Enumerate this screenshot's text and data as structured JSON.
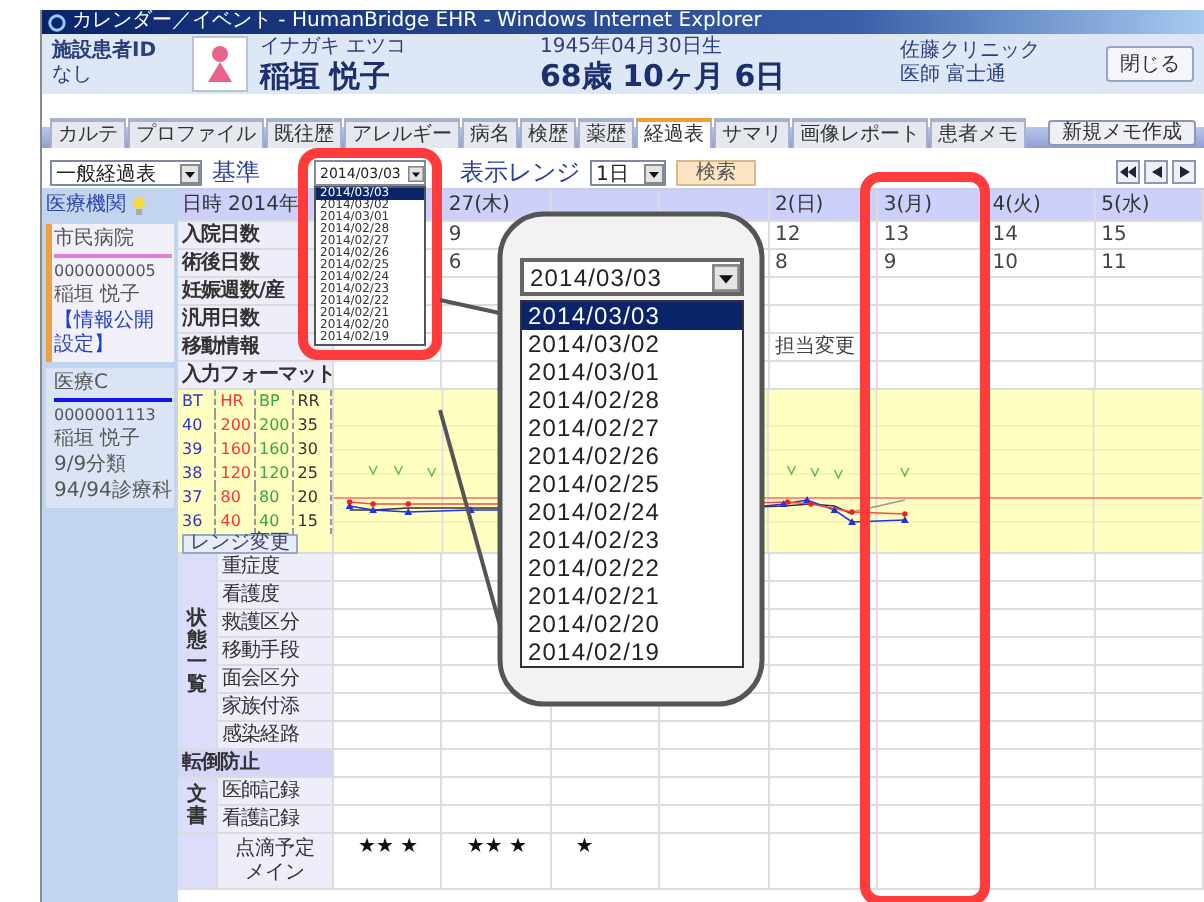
{
  "window": {
    "title": "カレンダー／イベント - HumanBridge EHR - Windows Internet Explorer"
  },
  "patient": {
    "id_label": "施設患者ID",
    "id_value": "なし",
    "kana": "イナガキ エツコ",
    "name": "稲垣 悦子",
    "birth": "1945年04月30日生",
    "age": "68歳 10ヶ月 6日",
    "clinic": "佐藤クリニック",
    "doctor": "医師 富士通",
    "close_button": "閉じる"
  },
  "tabs": [
    {
      "label": "カルテ",
      "selected": false
    },
    {
      "label": "プロファイル",
      "selected": false
    },
    {
      "label": "既往歴",
      "selected": false
    },
    {
      "label": "アレルギー",
      "selected": false
    },
    {
      "label": "病名",
      "selected": false
    },
    {
      "label": "検歴",
      "selected": false
    },
    {
      "label": "薬歴",
      "selected": false
    },
    {
      "label": "経過表",
      "selected": true
    },
    {
      "label": "サマリ",
      "selected": false
    },
    {
      "label": "画像レポート",
      "selected": false
    },
    {
      "label": "患者メモ",
      "selected": false
    }
  ],
  "new_memo_button": "新規メモ作成",
  "toolbar": {
    "table_select": "一般経過表",
    "base_date_label": "基準",
    "date_select": {
      "value": "2014/03/03",
      "expanded": true,
      "highlighted": true,
      "options": [
        {
          "label": "2014/03/03",
          "selected": true
        },
        {
          "label": "2014/03/02",
          "selected": false
        },
        {
          "label": "2014/03/01",
          "selected": false
        },
        {
          "label": "2014/02/28",
          "selected": false
        },
        {
          "label": "2014/02/27",
          "selected": false
        },
        {
          "label": "2014/02/26",
          "selected": false
        },
        {
          "label": "2014/02/25",
          "selected": false
        },
        {
          "label": "2014/02/24",
          "selected": false
        },
        {
          "label": "2014/02/23",
          "selected": false
        },
        {
          "label": "2014/02/22",
          "selected": false
        },
        {
          "label": "2014/02/21",
          "selected": false
        },
        {
          "label": "2014/02/20",
          "selected": false
        },
        {
          "label": "2014/02/19",
          "selected": false
        }
      ]
    },
    "range_label": "表示レンジ",
    "range_select": "1日",
    "search_button": "検索"
  },
  "callout": {
    "value": "2014/03/03",
    "options": [
      {
        "label": "2014/03/03",
        "selected": true
      },
      {
        "label": "2014/03/02",
        "selected": false
      },
      {
        "label": "2014/03/01",
        "selected": false
      },
      {
        "label": "2014/02/28",
        "selected": false
      },
      {
        "label": "2014/02/27",
        "selected": false
      },
      {
        "label": "2014/02/26",
        "selected": false
      },
      {
        "label": "2014/02/25",
        "selected": false
      },
      {
        "label": "2014/02/24",
        "selected": false
      },
      {
        "label": "2014/02/23",
        "selected": false
      },
      {
        "label": "2014/02/22",
        "selected": false
      },
      {
        "label": "2014/02/21",
        "selected": false
      },
      {
        "label": "2014/02/20",
        "selected": false
      },
      {
        "label": "2014/02/19",
        "selected": false
      }
    ]
  },
  "sidebar": {
    "heading": "医療機関",
    "cards": [
      {
        "name": "市民病院",
        "id": "0000000005",
        "patient": "稲垣 悦子",
        "link": "【情報公開設定】",
        "color": "#e07ee0",
        "selected": true
      },
      {
        "name": "医療C",
        "id": "0000001113",
        "patient": "稲垣 悦子",
        "notes": [
          "9/9分類",
          "94/94診療科"
        ],
        "color": "#1414e6",
        "selected": false
      }
    ]
  },
  "grid": {
    "date_label": "日時",
    "year": "2014年",
    "days": [
      {
        "highlighted": false
      },
      {
        "header": "27(木)",
        "highlighted": false
      },
      {
        "highlighted": false
      },
      {
        "highlighted": false
      },
      {
        "header": "2(日)",
        "highlighted": false
      },
      {
        "header": "3(月)",
        "highlighted": true
      },
      {
        "header": "4(火)",
        "highlighted": false
      },
      {
        "header": "5(水)",
        "highlighted": false
      }
    ],
    "top_rows": [
      {
        "label": "入院日数",
        "cells": [
          null,
          "9",
          null,
          null,
          "12",
          "13",
          "14",
          "15"
        ]
      },
      {
        "label": "術後日数",
        "cells": [
          null,
          "6",
          null,
          null,
          "8",
          "9",
          "10",
          "11"
        ]
      },
      {
        "label": "妊娠週数/産"
      },
      {
        "label": "汎用日数"
      },
      {
        "label": "移動情報",
        "cells": [
          null,
          null,
          null,
          null,
          "担当変更",
          null,
          null,
          null
        ]
      },
      {
        "label": "入力フォーマット"
      }
    ],
    "vitals": {
      "columns": [
        {
          "label": "BT",
          "color": "#3333cc",
          "values": [
            "40",
            "39",
            "38",
            "37",
            "36"
          ]
        },
        {
          "label": "HR",
          "color": "#ff3333",
          "values": [
            "200",
            "160",
            "120",
            "80",
            "40"
          ]
        },
        {
          "label": "BP",
          "color": "#33aa33",
          "values": [
            "200",
            "160",
            "120",
            "80",
            "40"
          ]
        },
        {
          "label": "RR",
          "color": "#333333",
          "values": [
            "35",
            "30",
            "25",
            "20",
            "15"
          ]
        }
      ],
      "range_button": "レンジ変更"
    },
    "state_group": {
      "label": "状態一覧",
      "items": [
        "重症度",
        "看護度",
        "救護区分",
        "移動手段",
        "面会区分",
        "家族付添",
        "感染経路"
      ]
    },
    "fall_prevention": "転倒防止",
    "doc_group": {
      "label": "文書",
      "items": [
        "医師記録",
        "看護記録"
      ]
    },
    "drip_row": {
      "label": "点滴予定",
      "sublabel": "メイン",
      "cells": [
        "★★ ★",
        "★★ ★",
        "★",
        null,
        null,
        null,
        null,
        null
      ]
    }
  }
}
